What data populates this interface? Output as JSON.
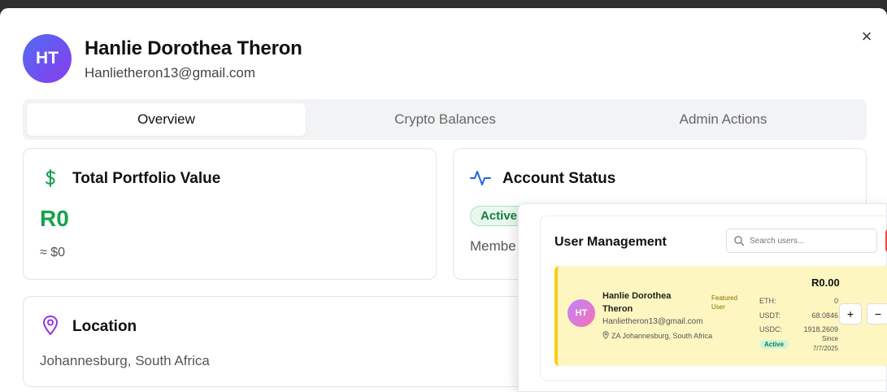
{
  "modal": {
    "close_icon": "×",
    "avatar_initials": "HT",
    "name": "Hanlie Dorothea Theron",
    "email": "Hanlietheron13@gmail.com"
  },
  "tabs": [
    {
      "label": "Overview",
      "active": true
    },
    {
      "label": "Crypto Balances",
      "active": false
    },
    {
      "label": "Admin Actions",
      "active": false
    }
  ],
  "portfolio": {
    "title": "Total Portfolio Value",
    "icon": "dollar-icon",
    "value": "R0",
    "approx": "≈ $0"
  },
  "account_status": {
    "title": "Account Status",
    "icon": "activity-icon",
    "status": "Active",
    "member_text": "Membe"
  },
  "location": {
    "title": "Location",
    "icon": "map-pin-icon",
    "value": "Johannesburg, South Africa"
  },
  "overlay": {
    "title": "User Management",
    "search_placeholder": "Search users...",
    "user": {
      "initials": "HT",
      "name": "Hanlie Dorothea Theron",
      "featured": "Featured User",
      "email": "Hanlietheron13@gmail.com",
      "location": "ZA Johannesburg, South Africa",
      "total": "R0.00",
      "balances": [
        {
          "label": "ETH:",
          "value": "0"
        },
        {
          "label": "USDT:",
          "value": "68.0846"
        },
        {
          "label": "USDC:",
          "value": "1918.2609"
        }
      ],
      "status": "Active",
      "since_label": "Since",
      "since_date": "7/7/2025",
      "plus": "+",
      "minus": "−"
    }
  },
  "colors": {
    "accent_green": "#16a34a",
    "avatar_gradient_start": "#4f6cf0",
    "avatar_gradient_end": "#8a3cf0",
    "featured_bg": "#fdf6c0",
    "featured_border": "#facc15"
  }
}
